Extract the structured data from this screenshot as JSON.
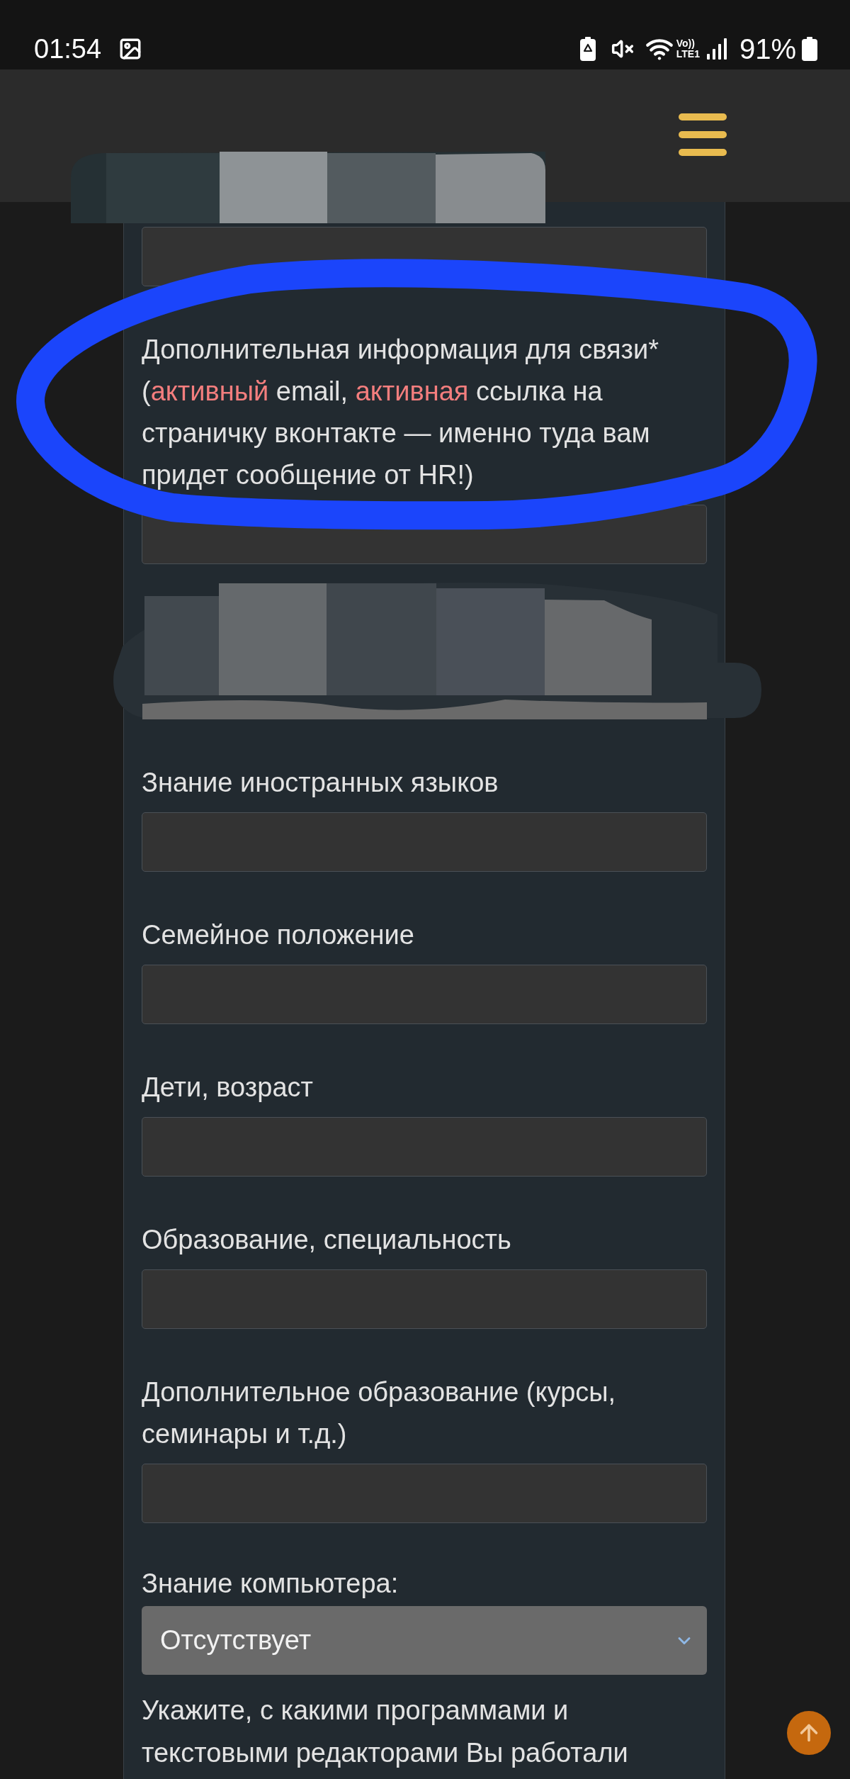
{
  "status_bar": {
    "time": "01:54",
    "network_label": [
      "Vo))",
      "LTE1"
    ],
    "battery_percent": "91%"
  },
  "form": {
    "fields": [
      {
        "kind": "redacted"
      },
      {
        "kind": "input"
      },
      {
        "kind": "input",
        "label_parts": [
          {
            "text": "Дополнительная информация для связи* (",
            "highlight": false
          },
          {
            "text": "активный",
            "highlight": true
          },
          {
            "text": " email, ",
            "highlight": false
          },
          {
            "text": "активная",
            "highlight": true
          },
          {
            "text": " ссылка на страничку вконтакте — именно туда вам придет сообщение от HR!)",
            "highlight": false
          }
        ]
      },
      {
        "kind": "redacted"
      },
      {
        "kind": "input",
        "label": "Знание иностранных языков"
      },
      {
        "kind": "input",
        "label": "Семейное положение"
      },
      {
        "kind": "input",
        "label": "Дети, возраст"
      },
      {
        "kind": "input",
        "label": "Образование, специальность"
      },
      {
        "kind": "input",
        "label": "Дополнительное образование (курсы, семинары и т.д.)"
      },
      {
        "kind": "select",
        "label": "Знание компьютера:",
        "value": "Отсутствует"
      },
      {
        "kind": "note",
        "text": "Укажите, с какими программами и текстовыми редакторами Вы работали"
      }
    ]
  }
}
